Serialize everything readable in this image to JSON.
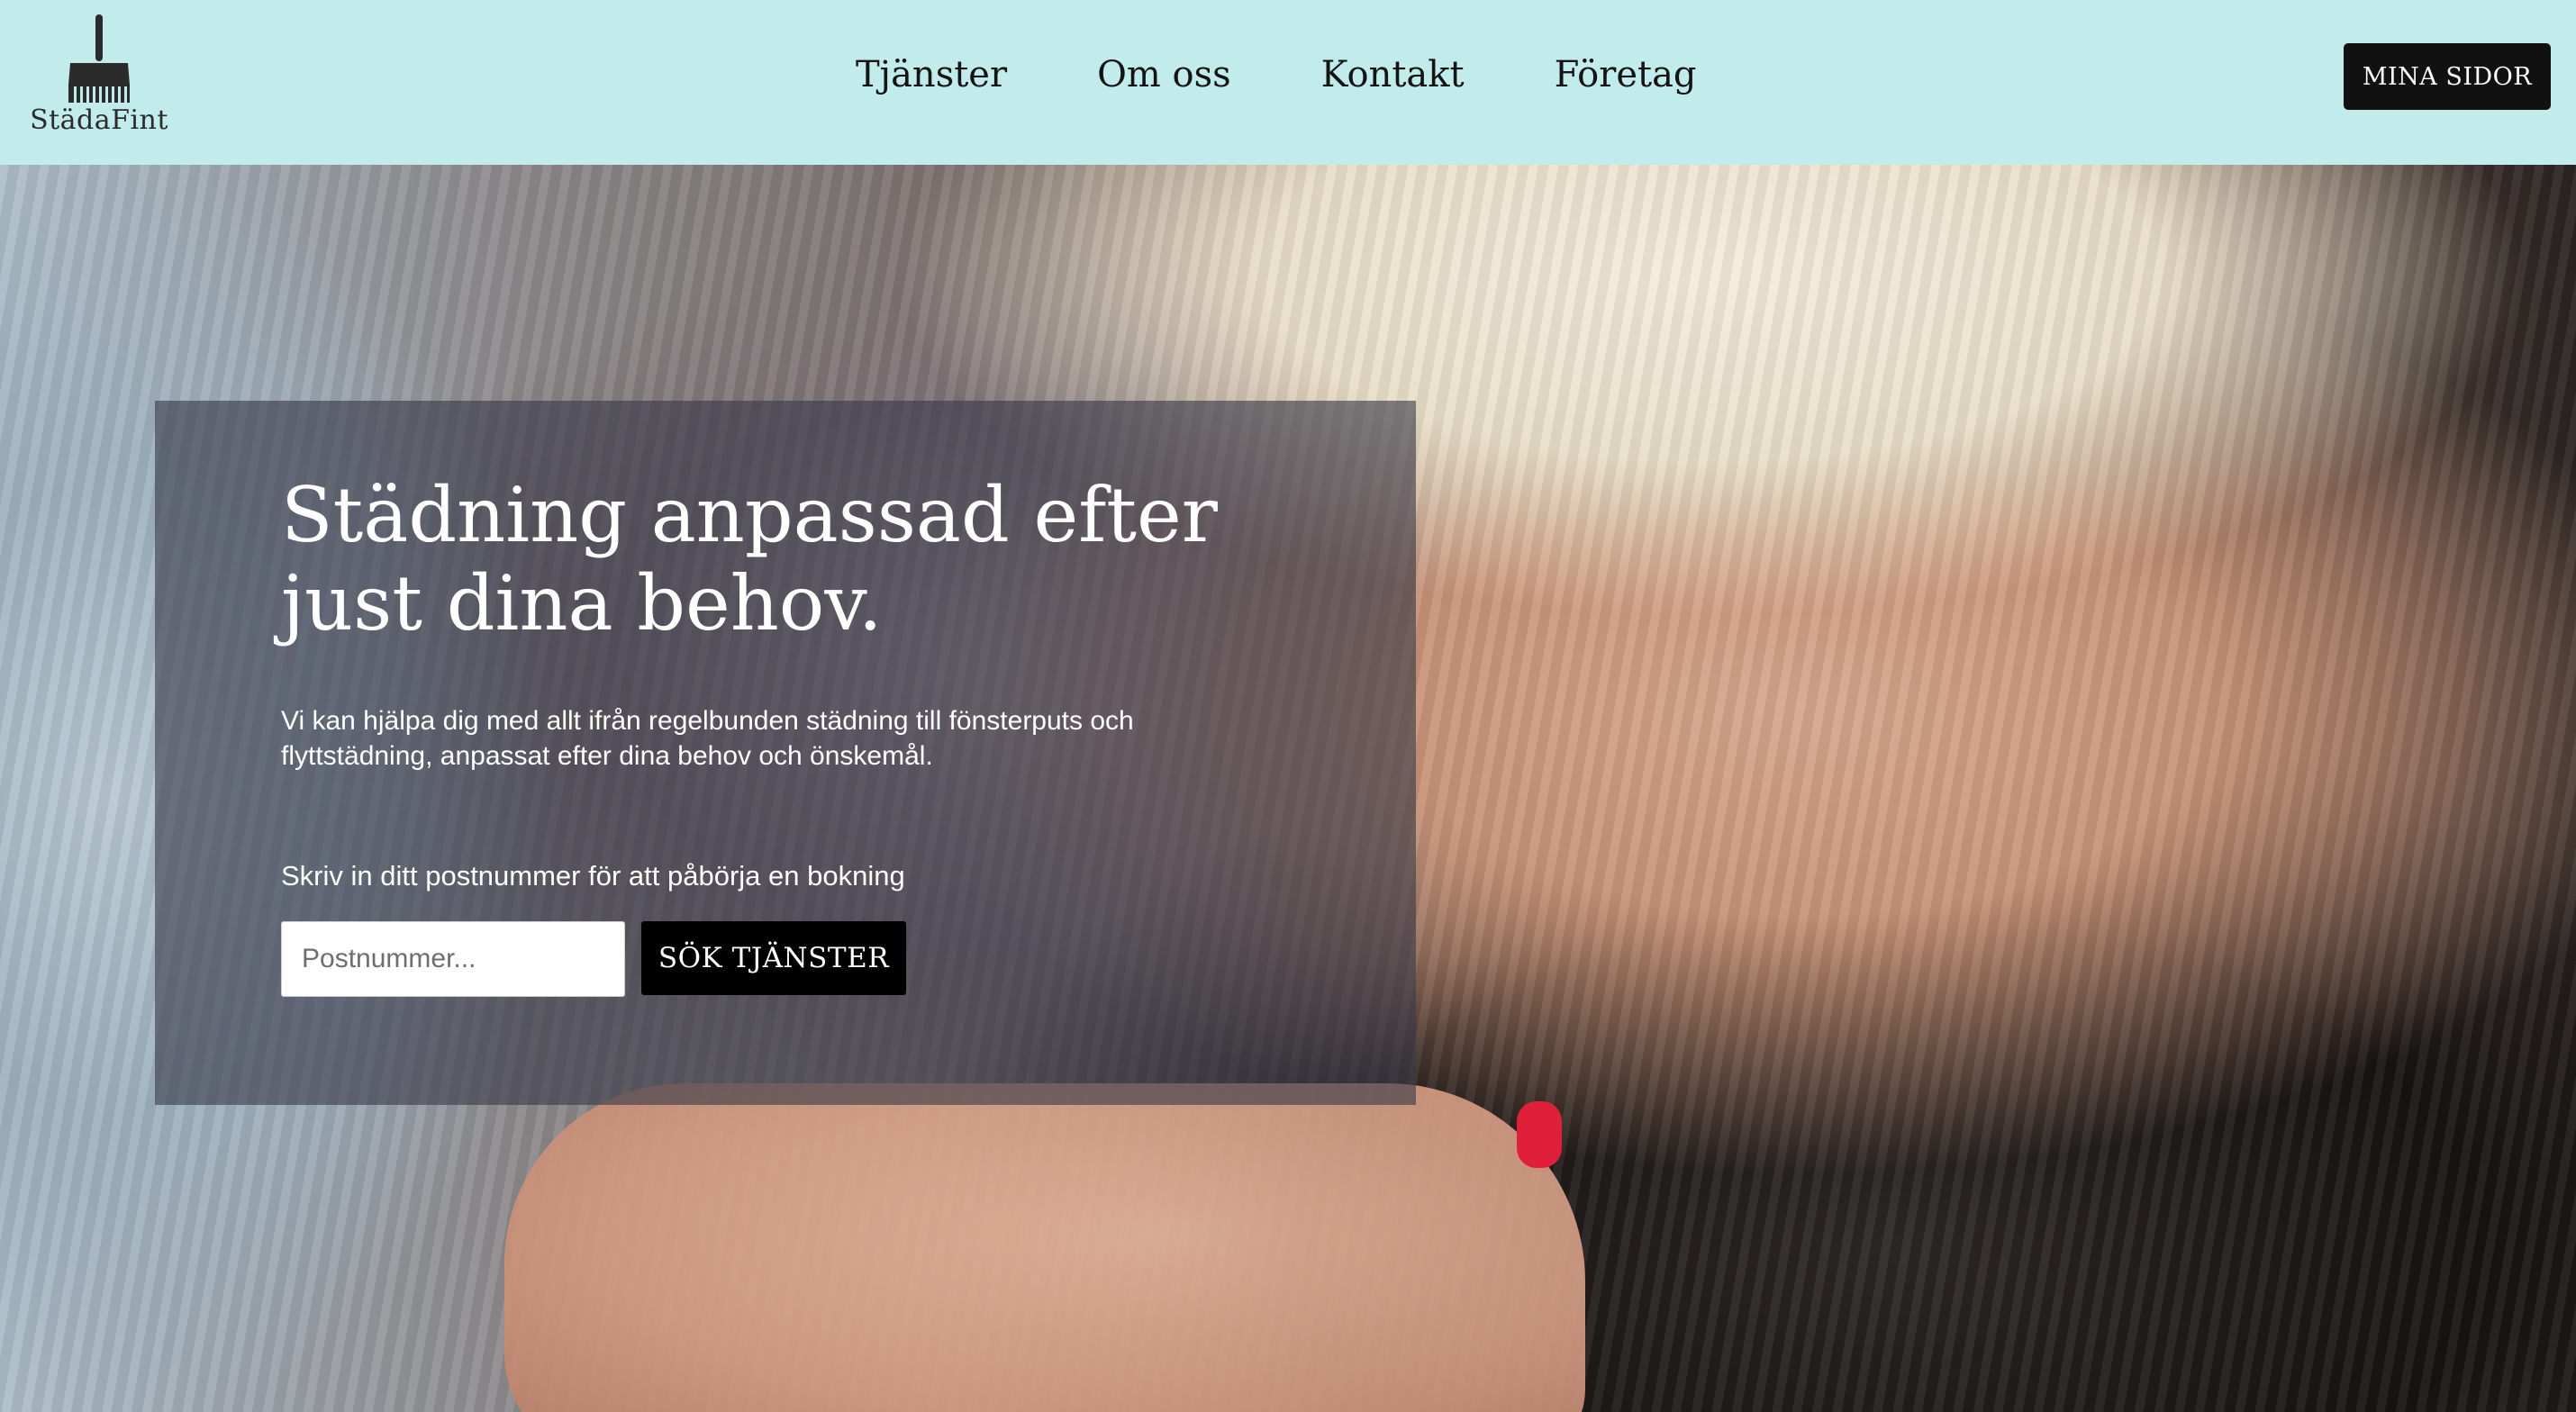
{
  "brand": {
    "name": "StädaFint",
    "logo_icon": "brush-icon"
  },
  "nav": {
    "items": [
      {
        "label": "Tjänster"
      },
      {
        "label": "Om oss"
      },
      {
        "label": "Kontakt"
      },
      {
        "label": "Företag"
      }
    ],
    "account_button": "MINA SIDOR"
  },
  "hero": {
    "title": "Städning anpassad efter just dina behov.",
    "description": "Vi kan hjälpa dig med allt ifrån regelbunden städning till fönsterputs och flyttstädning, anpassat efter dina behov och önskemål.",
    "prompt": "Skriv in ditt postnummer för att påbörja en bokning",
    "zip_placeholder": "Postnummer...",
    "zip_value": "",
    "search_button": "SÖK TJÄNSTER"
  },
  "colors": {
    "header_bg": "#c2ecec",
    "button_bg": "#111111",
    "overlay": "rgba(58,58,72,0.62)",
    "nail_accent": "#e0203a"
  }
}
